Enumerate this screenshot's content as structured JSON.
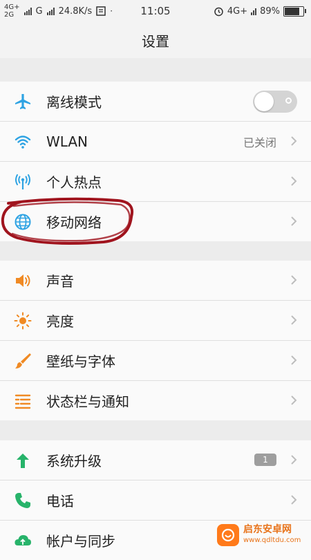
{
  "status_bar": {
    "net1": "4G+",
    "net2": "2G",
    "net3": "G",
    "speed": "24.8K/s",
    "time": "11:05",
    "net_right": "4G+",
    "battery": "89%",
    "battery_level": 0.89
  },
  "title": "设置",
  "colors": {
    "blue": "#2ea3e3",
    "orange": "#f08a24",
    "green": "#27b36a",
    "chevron": "#bdbdbd",
    "annotation": "#a0141e"
  },
  "groups": [
    {
      "items": [
        {
          "icon": "airplane-icon",
          "label": "离线模式",
          "toggle": "off"
        },
        {
          "icon": "wifi-icon",
          "label": "WLAN",
          "value": "已关闭"
        },
        {
          "icon": "hotspot-icon",
          "label": "个人热点"
        },
        {
          "icon": "globe-icon",
          "label": "移动网络"
        }
      ]
    },
    {
      "items": [
        {
          "icon": "speaker-icon",
          "label": "声音"
        },
        {
          "icon": "brightness-icon",
          "label": "亮度"
        },
        {
          "icon": "brush-icon",
          "label": "壁纸与字体"
        },
        {
          "icon": "statusbar-icon",
          "label": "状态栏与通知"
        }
      ]
    },
    {
      "items": [
        {
          "icon": "arrow-up-icon",
          "label": "系统升级",
          "badge": "1"
        },
        {
          "icon": "phone-icon",
          "label": "电话"
        },
        {
          "icon": "cloud-sync-icon",
          "label": "帐户与同步"
        }
      ]
    }
  ],
  "watermark": {
    "name": "启东安卓网",
    "url": "www.qdltdu.com"
  }
}
